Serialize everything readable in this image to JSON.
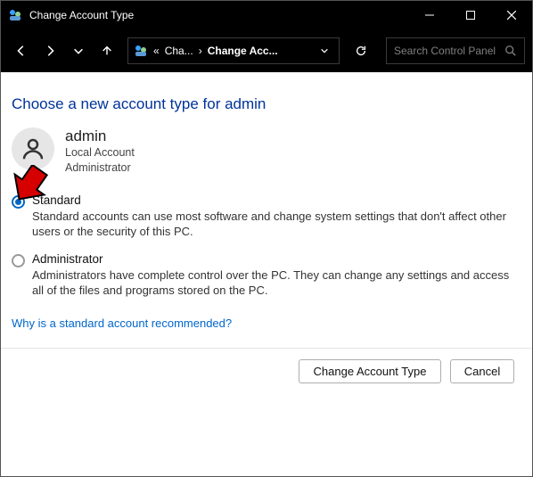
{
  "window": {
    "title": "Change Account Type"
  },
  "toolbar": {
    "breadcrumb1": "Cha...",
    "breadcrumb2": "Change Acc...",
    "search_placeholder": "Search Control Panel"
  },
  "page": {
    "heading": "Choose a new account type for admin",
    "user": {
      "name": "admin",
      "line1": "Local Account",
      "line2": "Administrator"
    },
    "options": {
      "standard": {
        "title": "Standard",
        "desc": "Standard accounts can use most software and change system settings that don't affect other users or the security of this PC.",
        "selected": true
      },
      "admin": {
        "title": "Administrator",
        "desc": "Administrators have complete control over the PC. They can change any settings and access all of the files and programs stored on the PC.",
        "selected": false
      }
    },
    "help_link": "Why is a standard account recommended?",
    "buttons": {
      "primary": "Change Account Type",
      "cancel": "Cancel"
    }
  }
}
